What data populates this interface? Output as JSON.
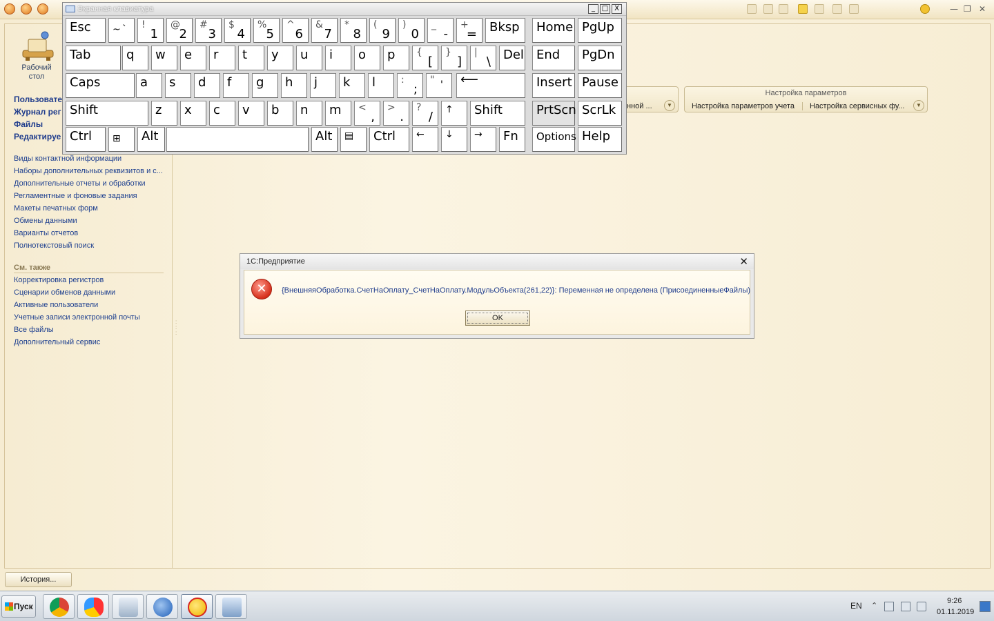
{
  "osk": {
    "title": "Экранная клавиатура",
    "controls": [
      "_",
      "□",
      "X"
    ],
    "keys": {
      "esc": "Esc",
      "tilde_shift": "~",
      "tilde_base": "`",
      "d1_shift": "!",
      "d1": "1",
      "d2_shift": "@",
      "d2": "2",
      "d3_shift": "#",
      "d3": "3",
      "d4_shift": "$",
      "d4": "4",
      "d5_shift": "%",
      "d5": "5",
      "d6_shift": "^",
      "d6": "6",
      "d7_shift": "&",
      "d7": "7",
      "d8_shift": "*",
      "d8": "8",
      "d9_shift": "(",
      "d9": "9",
      "d0_shift": ")",
      "d0": "0",
      "minus_shift": "_",
      "minus": "-",
      "plus_shift": "+",
      "plus": "=",
      "bksp": "Bksp",
      "home": "Home",
      "pgup": "PgUp",
      "tab": "Tab",
      "q": "q",
      "w": "w",
      "e": "e",
      "r": "r",
      "t": "t",
      "y": "y",
      "u": "u",
      "i": "i",
      "o": "o",
      "p": "p",
      "lbr_shift": "{",
      "lbr": "[",
      "rbr_shift": "}",
      "rbr": "]",
      "bsl_shift": "|",
      "bsl": "\\",
      "del": "Del",
      "end": "End",
      "pgdn": "PgDn",
      "caps": "Caps",
      "a": "a",
      "s": "s",
      "d": "d",
      "f": "f",
      "g": "g",
      "h": "h",
      "j": "j",
      "k": "k",
      "l": "l",
      "semi_shift": ":",
      "semi": ";",
      "quote_shift": "\"",
      "quote": "'",
      "enter": "⟵",
      "insert": "Insert",
      "pause": "Pause",
      "shift_l": "Shift",
      "z": "z",
      "x": "x",
      "c": "c",
      "v": "v",
      "b": "b",
      "n": "n",
      "m": "m",
      "comma_shift": "<",
      "comma": ",",
      "period_shift": ">",
      "period": ".",
      "slash_shift": "?",
      "slash": "/",
      "up": "↑",
      "shift_r": "Shift",
      "prtscn": "PrtScn",
      "scrlk": "ScrLk",
      "ctrl_l": "Ctrl",
      "win": "⊞",
      "alt_l": "Alt",
      "alt_r": "Alt",
      "menu": "▤",
      "ctrl_r": "Ctrl",
      "left": "←",
      "down": "↓",
      "right": "→",
      "fn": "Fn",
      "options": "Options",
      "help": "Help"
    }
  },
  "sidebar": {
    "desktop_label_1": "Рабочий",
    "desktop_label_2": "стол",
    "sections": [
      "Пользовате",
      "Журнал рег",
      "Файлы",
      "Редактируе"
    ],
    "links": [
      "Виды контактной информации",
      "Наборы дополнительных реквизитов и с...",
      "Дополнительные отчеты и обработки",
      "Регламентные и фоновые задания",
      "Макеты печатных форм",
      "Обмены данными",
      "Варианты отчетов",
      "Полнотекстовый поиск"
    ],
    "see_also_title": "См. также",
    "see_also": [
      "Корректировка регистров",
      "Сценарии обменов данными",
      "Активные пользователи",
      "Учетные записи электронной почты",
      "Все файлы",
      "Дополнительный сервис"
    ]
  },
  "panels": {
    "left_item": "нной ...",
    "settings_title": "Настройка параметров",
    "settings_item_1": "Настройка параметров учета",
    "settings_item_2": "Настройка сервисных фу..."
  },
  "history_button": "История...",
  "dialog": {
    "title": "1С:Предприятие",
    "close": "✕",
    "icon": "error-icon",
    "message": "{ВнешняяОбработка.СчетНаОплату_СчетНаОплату.МодульОбъекта(261,22)}: Переменная не определена (ПрисоединенныеФайлы)",
    "ok_label": "OK"
  },
  "taskbar": {
    "start_label": "Пуск",
    "apps": [
      "chrome-icon",
      "yandex-browser-icon",
      "file-manager-icon",
      "thunderbird-icon",
      "1c-icon",
      "on-screen-keyboard-icon"
    ],
    "language": "EN",
    "time": "9:26",
    "date": "01.11.2019"
  },
  "colors": {
    "accent": "#1f3c8c",
    "background": "#f6ecd2",
    "error": "#d6301c"
  }
}
